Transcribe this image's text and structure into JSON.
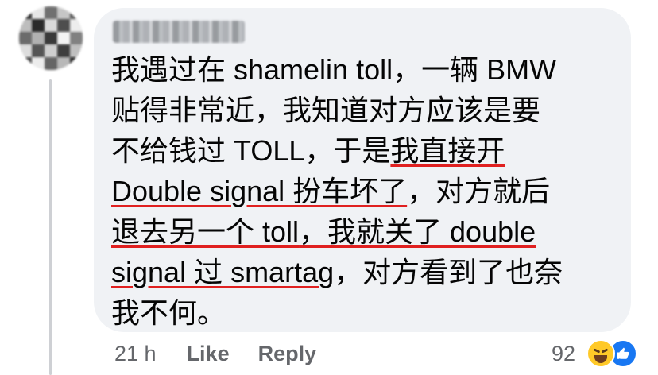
{
  "comment": {
    "lines": [
      "我遇过在 shamelin toll，一辆 BMW",
      "贴得非常近，我知道对方应该是要",
      "不给钱过 TOLL，于是",
      "我直接开",
      "Double signal 扮车坏了",
      "，对方就后",
      "退去另一个 toll",
      "，我就关了 double",
      "signal 过 smartag",
      "，对方看到了也奈",
      "我不何。"
    ]
  },
  "footer": {
    "time": "21 h",
    "like_label": "Like",
    "reply_label": "Reply",
    "reaction_count": "92"
  },
  "icons": {
    "haha": "haha-emoji-icon",
    "like": "like-icon"
  },
  "colors": {
    "bubble": "#f0f2f5",
    "underline": "#e02020",
    "text": "#050505",
    "secondary": "#65676b",
    "like_blue": "#1877f2",
    "haha_yellow": "#ffc928"
  }
}
